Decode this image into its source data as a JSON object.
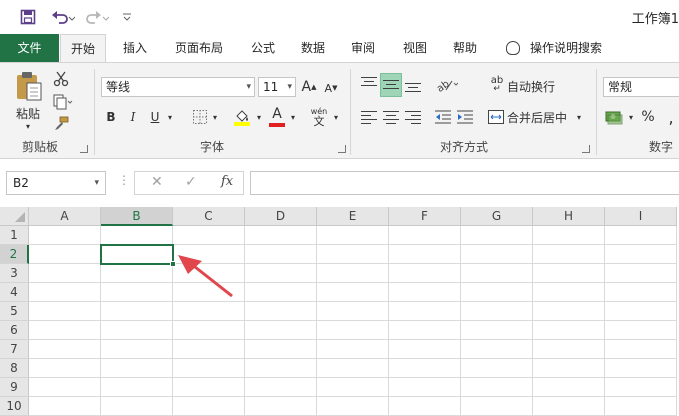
{
  "app": {
    "title": "工作簿1",
    "accent": "#217346",
    "arrow_color": "#e0464b"
  },
  "qat": {
    "save_icon": "save-icon",
    "undo_icon": "undo-icon",
    "redo_icon": "redo-icon",
    "customize_icon": "customize-qat-icon"
  },
  "tabs": [
    {
      "label": "文件"
    },
    {
      "label": "开始"
    },
    {
      "label": "插入"
    },
    {
      "label": "页面布局"
    },
    {
      "label": "公式"
    },
    {
      "label": "数据"
    },
    {
      "label": "审阅"
    },
    {
      "label": "视图"
    },
    {
      "label": "帮助"
    }
  ],
  "tell_me": "操作说明搜索",
  "ribbon": {
    "clipboard": {
      "label": "剪贴板",
      "paste_label": "粘贴"
    },
    "font": {
      "label": "字体",
      "font_name": "等线",
      "font_size": "11",
      "bold": "B",
      "italic": "I",
      "underline": "U",
      "grow": "A",
      "shrink": "A",
      "font_color": "A",
      "phonetic_top": "wén",
      "phonetic_bottom": "文"
    },
    "alignment": {
      "label": "对齐方式",
      "wrap_text": "自动换行",
      "merge_center": "合并后居中",
      "wrap_glyph": "ab"
    },
    "number": {
      "label": "数字",
      "format": "常规",
      "percent": "%"
    }
  },
  "formula_bar": {
    "name_box": "B2",
    "cancel": "✕",
    "enter": "✓",
    "fx": "fx",
    "value": ""
  },
  "sheet": {
    "columns": [
      "A",
      "B",
      "C",
      "D",
      "E",
      "F",
      "G",
      "H",
      "I"
    ],
    "rows": [
      "1",
      "2",
      "3",
      "4",
      "5",
      "6",
      "7",
      "8",
      "9",
      "10"
    ],
    "selected_column": "B",
    "selected_row": "2",
    "active_cell": "B2"
  }
}
